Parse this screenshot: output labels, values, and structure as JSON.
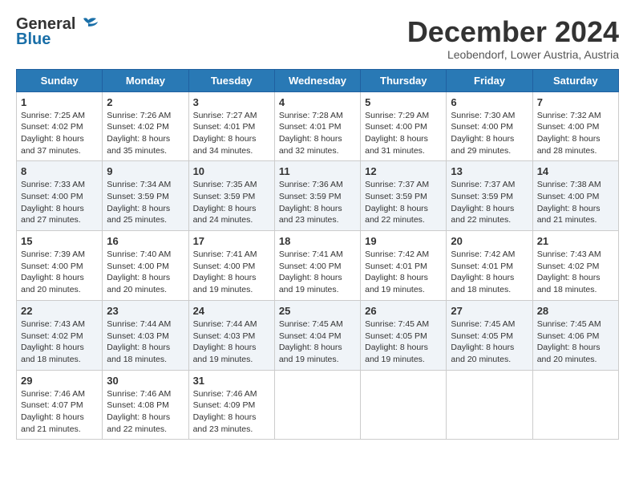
{
  "header": {
    "logo": {
      "line1": "General",
      "line2": "Blue"
    },
    "title": "December 2024",
    "location": "Leobendorf, Lower Austria, Austria"
  },
  "days_of_week": [
    "Sunday",
    "Monday",
    "Tuesday",
    "Wednesday",
    "Thursday",
    "Friday",
    "Saturday"
  ],
  "weeks": [
    [
      {
        "day": 1,
        "sunrise": "7:25 AM",
        "sunset": "4:02 PM",
        "daylight": "8 hours and 37 minutes."
      },
      {
        "day": 2,
        "sunrise": "7:26 AM",
        "sunset": "4:02 PM",
        "daylight": "8 hours and 35 minutes."
      },
      {
        "day": 3,
        "sunrise": "7:27 AM",
        "sunset": "4:01 PM",
        "daylight": "8 hours and 34 minutes."
      },
      {
        "day": 4,
        "sunrise": "7:28 AM",
        "sunset": "4:01 PM",
        "daylight": "8 hours and 32 minutes."
      },
      {
        "day": 5,
        "sunrise": "7:29 AM",
        "sunset": "4:00 PM",
        "daylight": "8 hours and 31 minutes."
      },
      {
        "day": 6,
        "sunrise": "7:30 AM",
        "sunset": "4:00 PM",
        "daylight": "8 hours and 29 minutes."
      },
      {
        "day": 7,
        "sunrise": "7:32 AM",
        "sunset": "4:00 PM",
        "daylight": "8 hours and 28 minutes."
      }
    ],
    [
      {
        "day": 8,
        "sunrise": "7:33 AM",
        "sunset": "4:00 PM",
        "daylight": "8 hours and 27 minutes."
      },
      {
        "day": 9,
        "sunrise": "7:34 AM",
        "sunset": "3:59 PM",
        "daylight": "8 hours and 25 minutes."
      },
      {
        "day": 10,
        "sunrise": "7:35 AM",
        "sunset": "3:59 PM",
        "daylight": "8 hours and 24 minutes."
      },
      {
        "day": 11,
        "sunrise": "7:36 AM",
        "sunset": "3:59 PM",
        "daylight": "8 hours and 23 minutes."
      },
      {
        "day": 12,
        "sunrise": "7:37 AM",
        "sunset": "3:59 PM",
        "daylight": "8 hours and 22 minutes."
      },
      {
        "day": 13,
        "sunrise": "7:37 AM",
        "sunset": "3:59 PM",
        "daylight": "8 hours and 22 minutes."
      },
      {
        "day": 14,
        "sunrise": "7:38 AM",
        "sunset": "4:00 PM",
        "daylight": "8 hours and 21 minutes."
      }
    ],
    [
      {
        "day": 15,
        "sunrise": "7:39 AM",
        "sunset": "4:00 PM",
        "daylight": "8 hours and 20 minutes."
      },
      {
        "day": 16,
        "sunrise": "7:40 AM",
        "sunset": "4:00 PM",
        "daylight": "8 hours and 20 minutes."
      },
      {
        "day": 17,
        "sunrise": "7:41 AM",
        "sunset": "4:00 PM",
        "daylight": "8 hours and 19 minutes."
      },
      {
        "day": 18,
        "sunrise": "7:41 AM",
        "sunset": "4:00 PM",
        "daylight": "8 hours and 19 minutes."
      },
      {
        "day": 19,
        "sunrise": "7:42 AM",
        "sunset": "4:01 PM",
        "daylight": "8 hours and 19 minutes."
      },
      {
        "day": 20,
        "sunrise": "7:42 AM",
        "sunset": "4:01 PM",
        "daylight": "8 hours and 18 minutes."
      },
      {
        "day": 21,
        "sunrise": "7:43 AM",
        "sunset": "4:02 PM",
        "daylight": "8 hours and 18 minutes."
      }
    ],
    [
      {
        "day": 22,
        "sunrise": "7:43 AM",
        "sunset": "4:02 PM",
        "daylight": "8 hours and 18 minutes."
      },
      {
        "day": 23,
        "sunrise": "7:44 AM",
        "sunset": "4:03 PM",
        "daylight": "8 hours and 18 minutes."
      },
      {
        "day": 24,
        "sunrise": "7:44 AM",
        "sunset": "4:03 PM",
        "daylight": "8 hours and 19 minutes."
      },
      {
        "day": 25,
        "sunrise": "7:45 AM",
        "sunset": "4:04 PM",
        "daylight": "8 hours and 19 minutes."
      },
      {
        "day": 26,
        "sunrise": "7:45 AM",
        "sunset": "4:05 PM",
        "daylight": "8 hours and 19 minutes."
      },
      {
        "day": 27,
        "sunrise": "7:45 AM",
        "sunset": "4:05 PM",
        "daylight": "8 hours and 20 minutes."
      },
      {
        "day": 28,
        "sunrise": "7:45 AM",
        "sunset": "4:06 PM",
        "daylight": "8 hours and 20 minutes."
      }
    ],
    [
      {
        "day": 29,
        "sunrise": "7:46 AM",
        "sunset": "4:07 PM",
        "daylight": "8 hours and 21 minutes."
      },
      {
        "day": 30,
        "sunrise": "7:46 AM",
        "sunset": "4:08 PM",
        "daylight": "8 hours and 22 minutes."
      },
      {
        "day": 31,
        "sunrise": "7:46 AM",
        "sunset": "4:09 PM",
        "daylight": "8 hours and 23 minutes."
      },
      null,
      null,
      null,
      null
    ]
  ]
}
